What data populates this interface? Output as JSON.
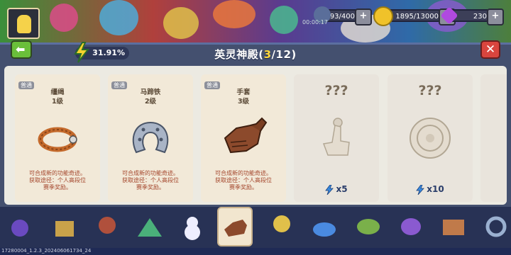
{
  "hud": {
    "stamina": "93/400",
    "coins": "1895/13000",
    "gems": "230",
    "timer": "00:00:17"
  },
  "header": {
    "title_prefix": "英灵神殿(",
    "title_count": "3",
    "title_suffix": "/12)",
    "progress": "31.91%"
  },
  "cards": [
    {
      "rarity": "普通",
      "name": "缰绳",
      "level": "1级",
      "desc": [
        "可合成新的功能奇迹。",
        "获取途径：个人高段位",
        "赛季奖励。"
      ]
    },
    {
      "rarity": "普通",
      "name": "马蹄铁",
      "level": "2级",
      "desc": [
        "可合成新的功能奇迹。",
        "获取途径：个人高段位",
        "赛季奖励。"
      ]
    },
    {
      "rarity": "普通",
      "name": "手套",
      "level": "3级",
      "desc": [
        "可合成新的功能奇迹。",
        "获取途径：个人高段位",
        "赛季奖励。"
      ]
    },
    {
      "title": "???",
      "cost": "x5"
    },
    {
      "title": "???",
      "cost": "x10"
    }
  ],
  "footer": "17280004_1.2.3_202406061734_24",
  "colors": {
    "accent_yellow": "#ffd83a",
    "close_red": "#d9453e",
    "back_green": "#6abf3a",
    "desc_red": "#a3442a"
  }
}
